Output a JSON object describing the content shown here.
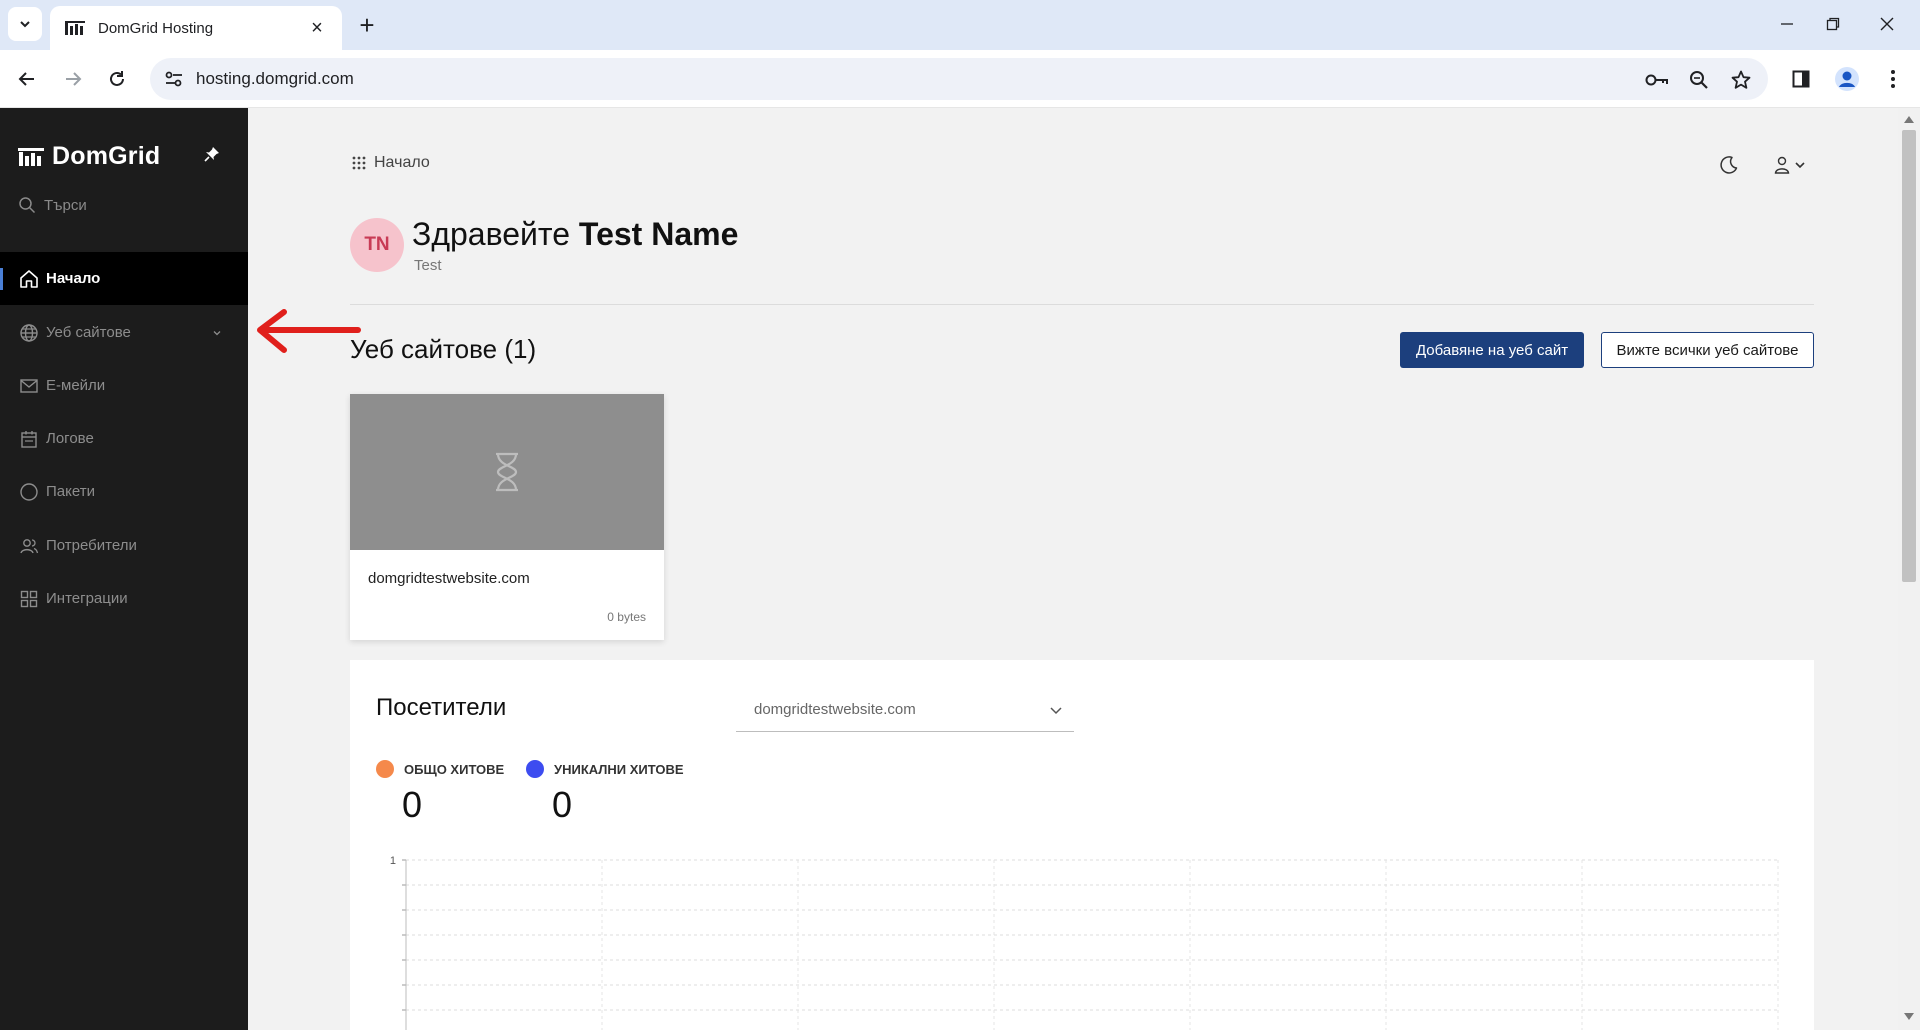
{
  "browser": {
    "tab_title": "DomGrid Hosting",
    "url": "hosting.domgrid.com"
  },
  "sidebar": {
    "brand": "DomGrid",
    "search_label": "Търси",
    "items": [
      {
        "label": "Начало",
        "icon": "home-icon",
        "active": true
      },
      {
        "label": "Уеб сайтове",
        "icon": "globe-icon",
        "active": false
      },
      {
        "label": "Е-мейли",
        "icon": "mail-icon",
        "active": false
      },
      {
        "label": "Логове",
        "icon": "calendar-icon",
        "active": false
      },
      {
        "label": "Пакети",
        "icon": "circle-icon",
        "active": false
      },
      {
        "label": "Потребители",
        "icon": "users-icon",
        "active": false
      },
      {
        "label": "Интеграции",
        "icon": "grid-icon",
        "active": false
      }
    ]
  },
  "header": {
    "breadcrumb": "Начало"
  },
  "user": {
    "initials": "TN",
    "greeting_prefix": "Здравейте",
    "name": "Test Name",
    "subtitle": "Test"
  },
  "websites": {
    "title": "Уеб сайтове",
    "count": "(1)",
    "add_button": "Добавяне на уеб сайт",
    "view_all_button": "Вижте всички уеб сайтове",
    "cards": [
      {
        "domain": "domgridtestwebsite.com",
        "size": "0 bytes"
      }
    ]
  },
  "visitors": {
    "title": "Посетители",
    "selected_site": "domgridtestwebsite.com",
    "legend": [
      {
        "label": "ОБЩО ХИТОВЕ",
        "value": "0",
        "color": "#f5894b"
      },
      {
        "label": "УНИКАЛНИ ХИТОВЕ",
        "value": "0",
        "color": "#3d4cf0"
      }
    ]
  },
  "chart_data": {
    "type": "line",
    "title": "",
    "series": [],
    "y_tick_labels": [
      "1"
    ],
    "grid": true
  },
  "colors": {
    "sidebar_bg": "#1c1c1c",
    "primary": "#1c3f7d",
    "active_indicator": "#4a7fd6",
    "avatar_bg": "#f6c3cc",
    "avatar_text": "#c83b55"
  }
}
